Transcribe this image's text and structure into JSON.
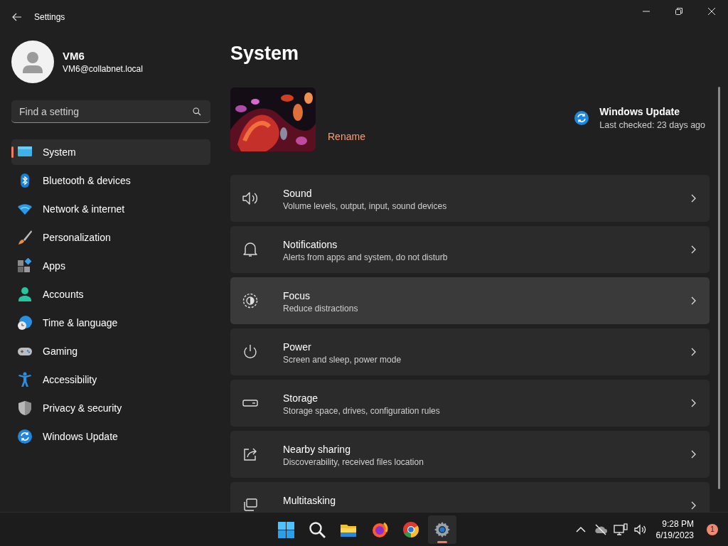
{
  "window": {
    "title": "Settings"
  },
  "account": {
    "name": "VM6",
    "email": "VM6@collabnet.local"
  },
  "search": {
    "placeholder": "Find a setting"
  },
  "sidebar": {
    "items": [
      {
        "label": "System",
        "selected": true
      },
      {
        "label": "Bluetooth & devices",
        "selected": false
      },
      {
        "label": "Network & internet",
        "selected": false
      },
      {
        "label": "Personalization",
        "selected": false
      },
      {
        "label": "Apps",
        "selected": false
      },
      {
        "label": "Accounts",
        "selected": false
      },
      {
        "label": "Time & language",
        "selected": false
      },
      {
        "label": "Gaming",
        "selected": false
      },
      {
        "label": "Accessibility",
        "selected": false
      },
      {
        "label": "Privacy & security",
        "selected": false
      },
      {
        "label": "Windows Update",
        "selected": false
      }
    ]
  },
  "page": {
    "title": "System",
    "device": {
      "kind": "picture",
      "action": "Rename"
    },
    "update": {
      "title": "Windows Update",
      "subtitle": "Last checked: 23 days ago"
    }
  },
  "cards": [
    {
      "title": "Sound",
      "subtitle": "Volume levels, output, input, sound devices",
      "hovered": false
    },
    {
      "title": "Notifications",
      "subtitle": "Alerts from apps and system, do not disturb",
      "hovered": false
    },
    {
      "title": "Focus",
      "subtitle": "Reduce distractions",
      "hovered": true
    },
    {
      "title": "Power",
      "subtitle": "Screen and sleep, power mode",
      "hovered": false
    },
    {
      "title": "Storage",
      "subtitle": "Storage space, drives, configuration rules",
      "hovered": false
    },
    {
      "title": "Nearby sharing",
      "subtitle": "Discoverability, received files location",
      "hovered": false
    },
    {
      "title": "Multitasking",
      "hovered": false
    }
  ],
  "taskbar": {
    "apps": [
      {
        "selected": false
      },
      {
        "selected": false
      },
      {
        "selected": false
      },
      {
        "selected": false
      },
      {
        "selected": false
      },
      {
        "selected": true
      }
    ],
    "clock": {
      "time": "9:28 PM",
      "date": "6/19/2023"
    },
    "notifications": {
      "count": "1"
    }
  }
}
